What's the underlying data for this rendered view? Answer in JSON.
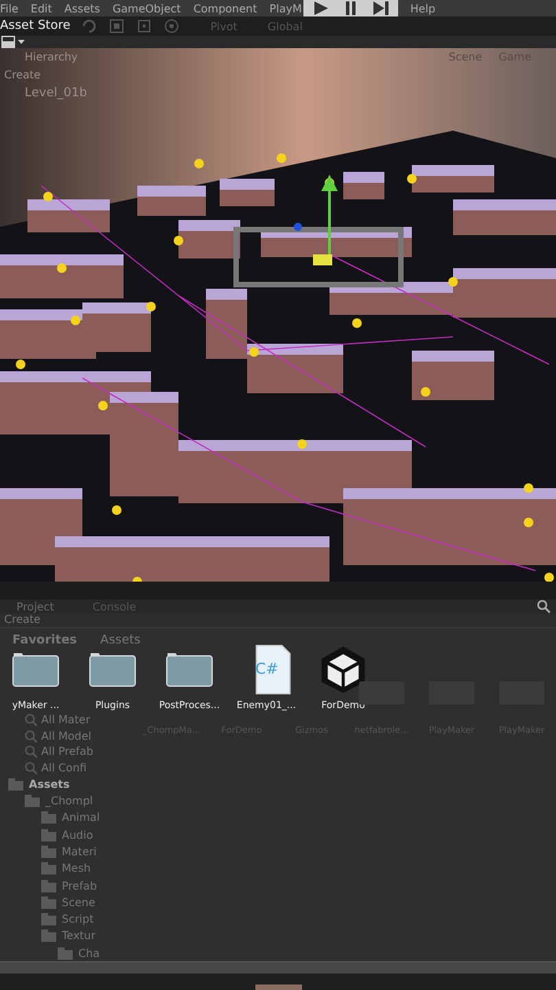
{
  "menu_bar": {
    "items": [
      "File",
      "Edit",
      "Assets",
      "GameObject",
      "Component",
      "PlayM",
      "Help"
    ]
  },
  "play_controls": [
    {
      "kind": "play"
    },
    {
      "kind": "pause"
    },
    {
      "kind": "step"
    }
  ],
  "toolbar": {
    "tab": "Asset Store",
    "pivot": "Pivot",
    "global": "Global"
  },
  "scene_overlay": {
    "hierarchy": "Hierarchy",
    "create": "Create",
    "level": "Level_01b",
    "scene": "Scene",
    "game": "Game"
  },
  "project": {
    "tabs": [
      {
        "label": "Project",
        "selected": true
      },
      {
        "label": "Console",
        "selected": false
      }
    ],
    "create": "Create",
    "favorites": "Favorites",
    "breadcrumb": "Assets",
    "favorite_items": [
      "All Mater",
      "All Model",
      "All Prefab",
      "All Confi"
    ],
    "assets": [
      {
        "name": "yMaker ...",
        "kind": "folder"
      },
      {
        "name": "Plugins",
        "kind": "folder"
      },
      {
        "name": "PostProces...",
        "kind": "folder"
      },
      {
        "name": "Enemy01_...",
        "kind": "script",
        "glyph": "C#"
      },
      {
        "name": "ForDemo",
        "kind": "unity"
      }
    ],
    "faded_assets": [
      "_ChompMa...",
      "ForDemo",
      "Gizmos",
      "netfabrole...",
      "PlayMaker",
      "PlayMaker"
    ],
    "tree": [
      {
        "label": "Assets",
        "children": [
          {
            "label": "_Chompl",
            "children": [
              {
                "label": "Animal"
              },
              {
                "label": "Audio"
              },
              {
                "label": "Materi"
              },
              {
                "label": "Mesh"
              },
              {
                "label": "Prefab"
              },
              {
                "label": "Scene"
              },
              {
                "label": "Script"
              },
              {
                "label": "Textur",
                "children": [
                  {
                    "label": "Cha"
                  }
                ]
              }
            ]
          }
        ]
      }
    ]
  }
}
